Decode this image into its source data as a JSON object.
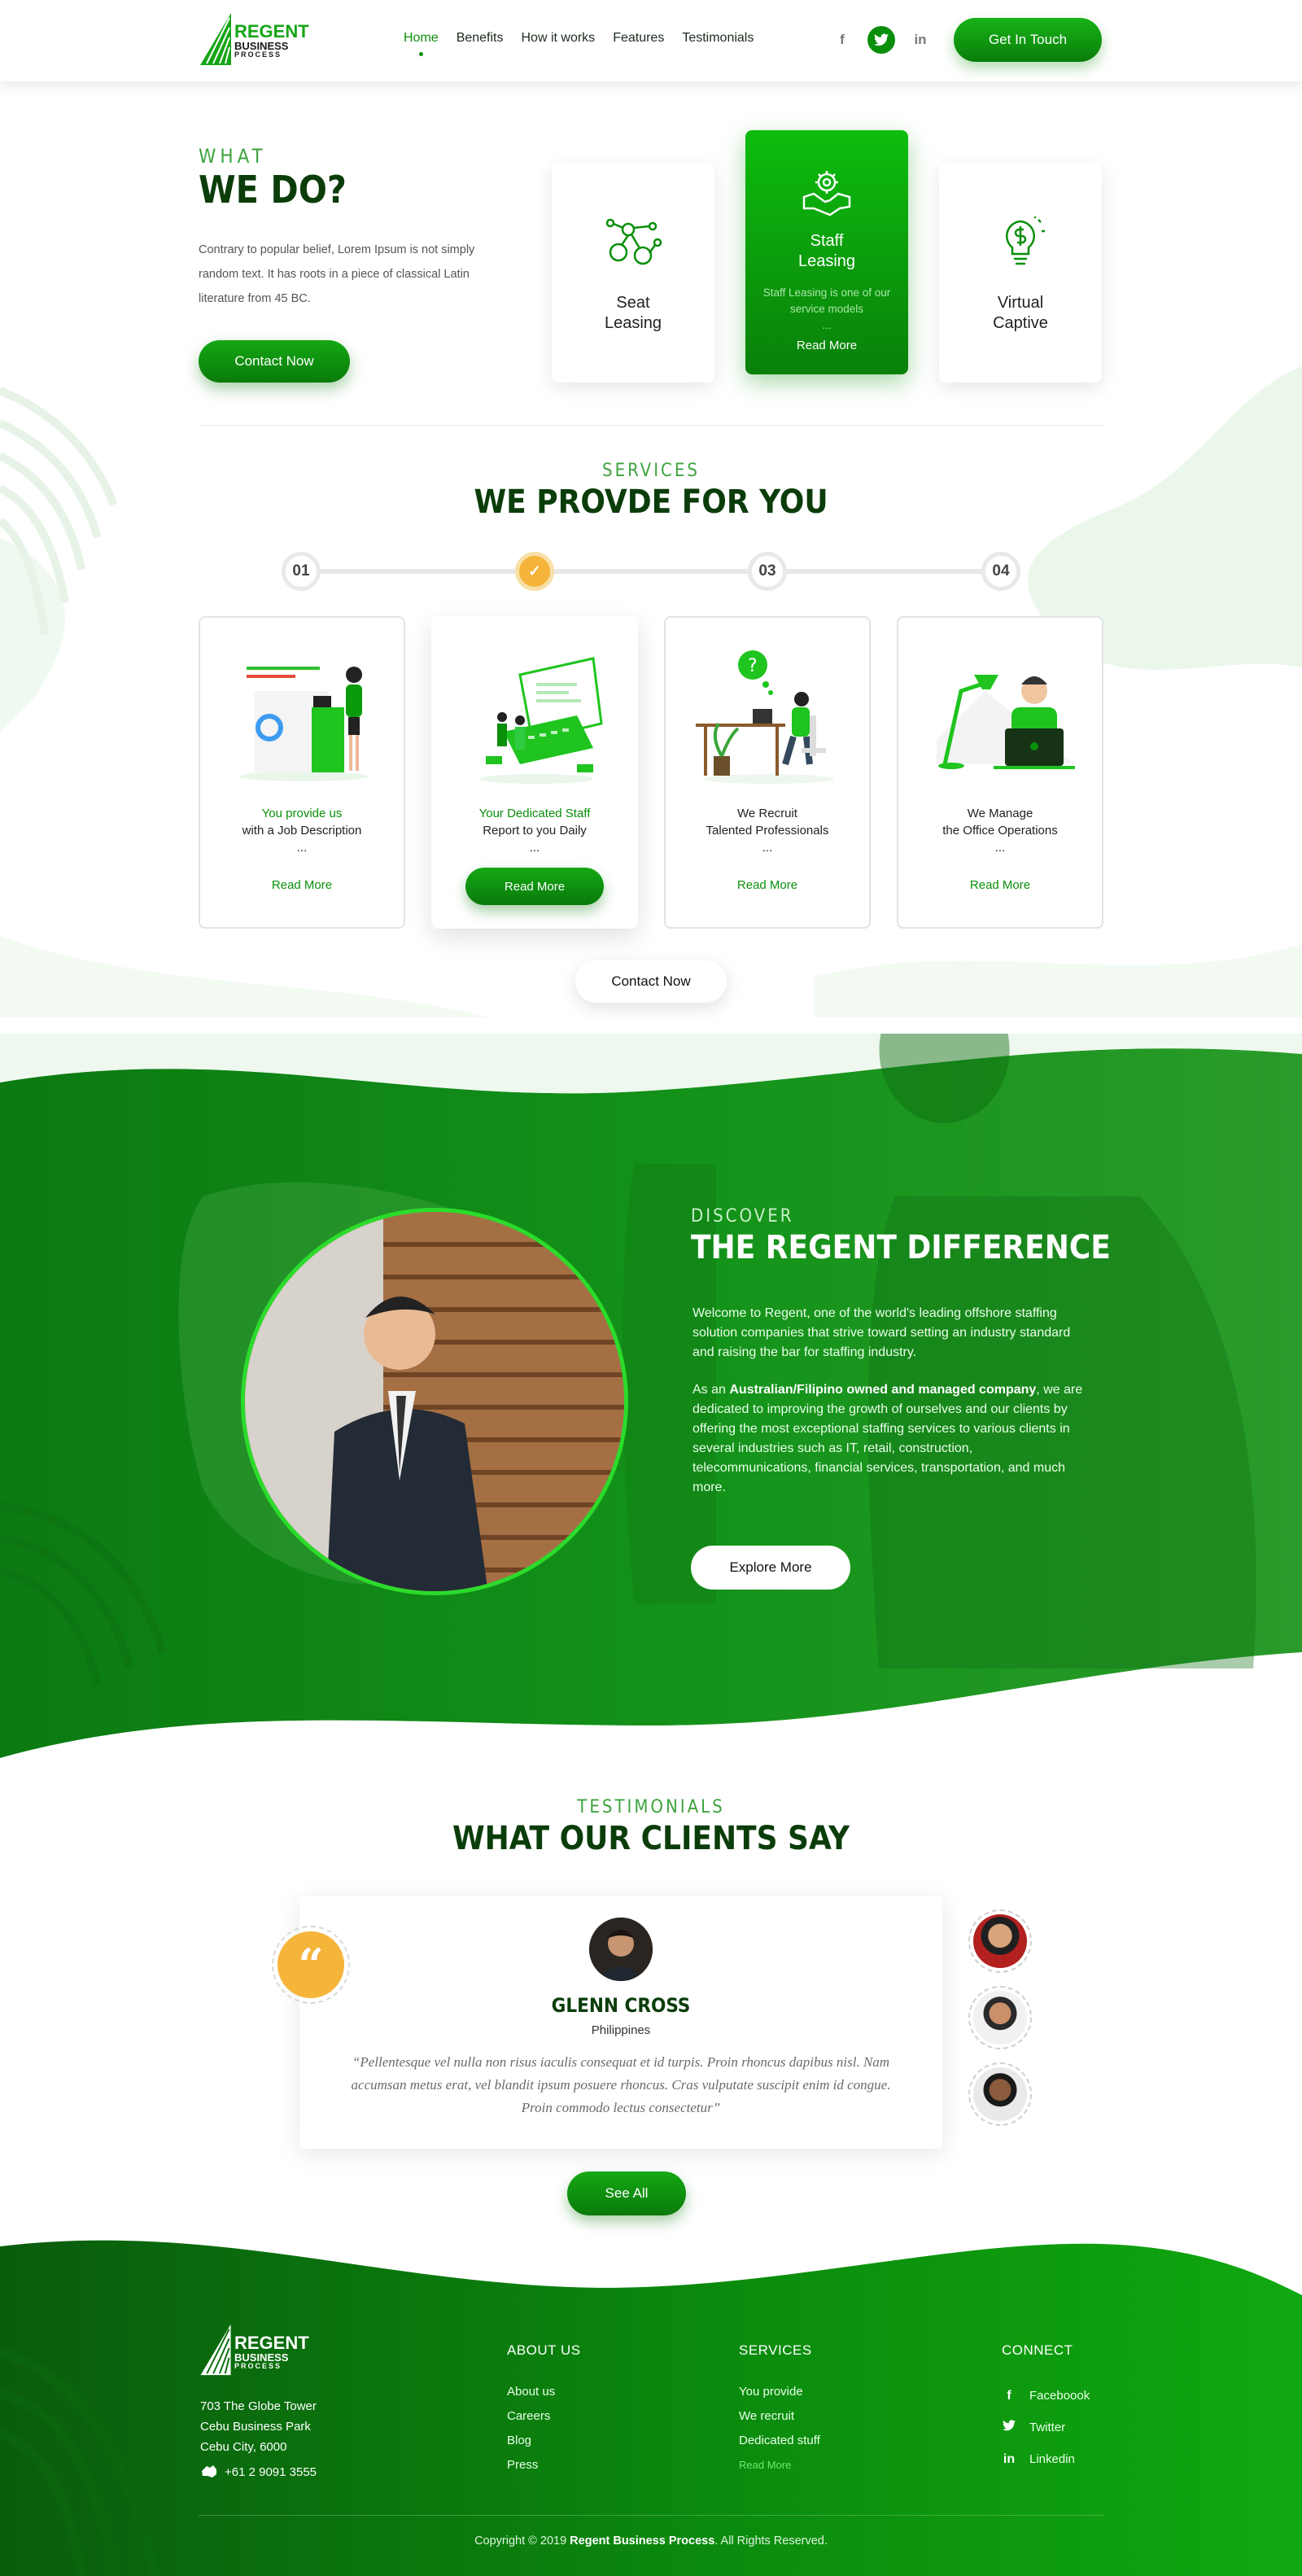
{
  "brand": {
    "line1": "REGENT",
    "line2": "BUSINESS",
    "line3": "PROCESS"
  },
  "nav": {
    "items": [
      "Home",
      "Benefits",
      "How it works",
      "Features",
      "Testimonials"
    ],
    "active": "Home"
  },
  "social": {
    "facebook": "f",
    "twitter": "t",
    "linkedin": "in"
  },
  "header_cta": "Get In Touch",
  "what": {
    "eyebrow": "WHAT",
    "title": "WE DO?",
    "text": "Contrary to popular belief, Lorem Ipsum is not simply random text. It has roots in a piece of classical Latin literature from 45 BC.",
    "cta": "Contact Now"
  },
  "service_cards": [
    {
      "title1": "Seat",
      "title2": "Leasing"
    },
    {
      "title1": "Staff",
      "title2": "Leasing",
      "desc": "Staff Leasing is one of our service models",
      "ellipsis": "...",
      "more": "Read More"
    },
    {
      "title1": "Virtual",
      "title2": "Captive"
    }
  ],
  "services": {
    "eyebrow": "SERVICES",
    "title": "WE PROVDE FOR YOU",
    "steps": [
      "01",
      "✓",
      "03",
      "04"
    ],
    "cards": [
      {
        "strong": "You provide us",
        "line2": "with a Job Description",
        "ellipsis": "...",
        "more": "Read More"
      },
      {
        "strong": "Your Dedicated Staff",
        "line2": "Report to you Daily",
        "ellipsis": "...",
        "more": "Read More"
      },
      {
        "strong": "We Recruit",
        "line2": "Talented Professionals",
        "ellipsis": "...",
        "more": "Read More"
      },
      {
        "strong": "We Manage",
        "line2": "the Office Operations",
        "ellipsis": "...",
        "more": "Read More"
      }
    ],
    "cta": "Contact Now"
  },
  "discover": {
    "eyebrow": "DISCOVER",
    "title": "THE REGENT DIFFERENCE",
    "p1": "Welcome to Regent, one of the world's leading offshore staffing solution companies that strive toward setting an industry standard and raising the bar for staffing industry.",
    "p2_pre": "As an ",
    "p2_bold": "Australian/Filipino owned and managed company",
    "p2_post": ", we are dedicated to improving the growth of ourselves and our clients by offering the most exceptional staffing services to various clients in several industries such as IT, retail, construction, telecommunications, financial services, transportation, and much more.",
    "cta": "Explore More"
  },
  "testimonials": {
    "eyebrow": "TESTIMONIALS",
    "title": "WHAT OUR CLIENTS SAY",
    "quote_mark": "“",
    "name": "GLENN CROSS",
    "location": "Philippines",
    "quote": "“Pellentesque vel nulla non risus iaculis consequat et id turpis. Proin rhoncus dapibus nisl. Nam accumsan metus erat, vel blandit ipsum posuere rhoncus. Cras vulputate suscipit enim id congue. Proin commodo lectus consectetur”",
    "cta": "See All"
  },
  "footer": {
    "address": [
      "703 The Globe Tower",
      "Cebu Business Park",
      "Cebu City, 6000"
    ],
    "phone": "+61 2 9091 3555",
    "about": {
      "title": "ABOUT US",
      "links": [
        "About us",
        "Careers",
        "Blog",
        "Press"
      ]
    },
    "services": {
      "title": "SERVICES",
      "links": [
        "You provide",
        "We recruit",
        "Dedicated stuff"
      ],
      "more": "Read More"
    },
    "connect": {
      "title": "CONNECT",
      "links": [
        {
          "icon": "f",
          "label": "Faceboook"
        },
        {
          "icon": "t",
          "label": "Twitter"
        },
        {
          "icon": "in",
          "label": "Linkedin"
        }
      ]
    },
    "copyright_pre": "Copyright © 2019 ",
    "copyright_bold": "Regent Business Process",
    "copyright_post": ". All Rights Reserved."
  },
  "colors": {
    "primary": "#0a8f0a",
    "dark": "#0b3d0b",
    "accent": "#f5b43a"
  }
}
